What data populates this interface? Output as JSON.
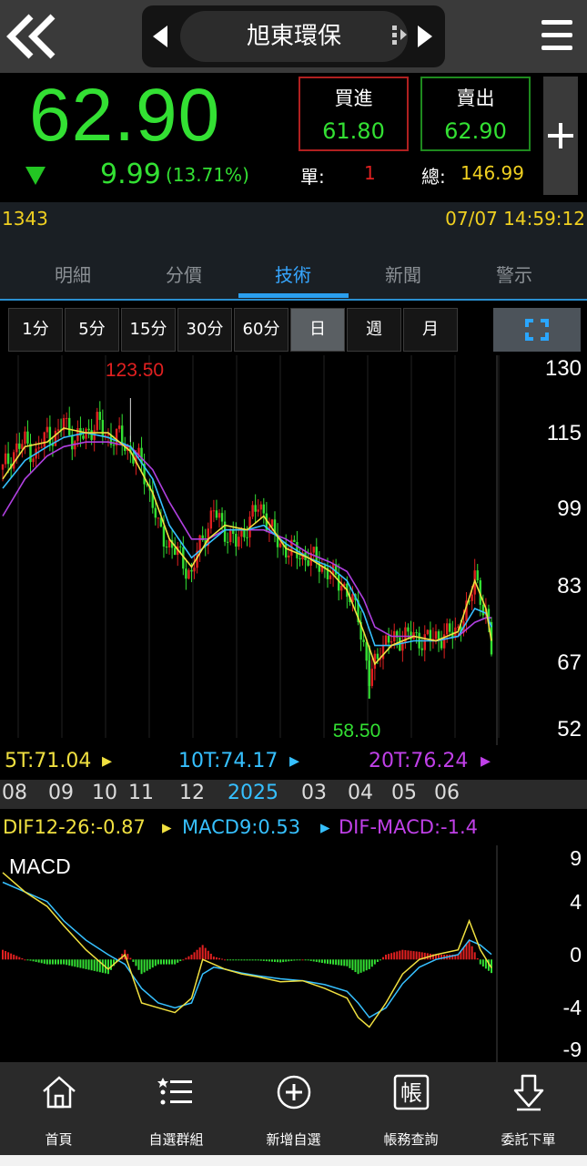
{
  "header": {
    "title": "旭東環保"
  },
  "quote": {
    "price": "62.90",
    "change": "9.99",
    "change_pct": "(13.71%)",
    "buy_label": "買進",
    "buy_price": "61.80",
    "sell_label": "賣出",
    "sell_price": "62.90",
    "unit_label": "單:",
    "unit_value": "1",
    "total_label": "總:",
    "total_value": "146.99",
    "stock_code": "1343",
    "datetime": "07/07 14:59:12"
  },
  "tabs": [
    "明細",
    "分價",
    "技術",
    "新聞",
    "警示"
  ],
  "active_tab": "技術",
  "periods": [
    "1分",
    "5分",
    "15分",
    "30分",
    "60分",
    "日",
    "週",
    "月"
  ],
  "active_period": "日",
  "ma": {
    "ma5": "5T:71.04",
    "ma10": "10T:74.17",
    "ma20": "20T:76.24"
  },
  "date_axis": [
    "08",
    "09",
    "10",
    "11",
    "12",
    "2025",
    "03",
    "04",
    "05",
    "06"
  ],
  "macd_legend": {
    "dif": "DIF12-26:-0.87",
    "macd9": "MACD9:0.53",
    "osc": "DIF-MACD:-1.4",
    "panel_label": "MACD"
  },
  "colors": {
    "up": "#e02020",
    "down": "#33e033",
    "ma5": "#f0e040",
    "ma10": "#36c0ff",
    "ma20": "#b040e0",
    "accent": "#2a9fef"
  },
  "chart_data": [
    {
      "type": "candlestick",
      "title": "",
      "y_ticks": [
        "130",
        "115",
        "99",
        "83",
        "67",
        "52"
      ],
      "ylim": [
        52,
        130
      ],
      "high_label": "123.50",
      "low_label": "58.50",
      "high": 123.5,
      "low": 58.5,
      "close_points": [
        [
          0,
          108
        ],
        [
          2,
          112
        ],
        [
          4,
          114
        ],
        [
          6,
          111
        ],
        [
          8,
          116
        ],
        [
          10,
          115
        ],
        [
          11,
          119
        ],
        [
          13,
          114
        ],
        [
          15,
          116
        ],
        [
          17,
          118
        ],
        [
          19,
          115
        ],
        [
          21,
          115
        ],
        [
          23,
          112
        ],
        [
          25,
          109
        ],
        [
          27,
          101
        ],
        [
          28,
          95
        ],
        [
          30,
          92
        ],
        [
          32,
          89
        ],
        [
          34,
          85
        ],
        [
          35,
          90
        ],
        [
          37,
          96
        ],
        [
          38,
          99
        ],
        [
          40,
          95
        ],
        [
          42,
          92
        ],
        [
          44,
          96
        ],
        [
          46,
          100
        ],
        [
          47,
          99
        ],
        [
          49,
          93
        ],
        [
          51,
          91
        ],
        [
          53,
          90
        ],
        [
          55,
          89
        ],
        [
          57,
          88
        ],
        [
          59,
          85
        ],
        [
          61,
          84
        ],
        [
          62,
          81
        ],
        [
          64,
          77
        ],
        [
          65,
          70
        ],
        [
          66,
          62
        ],
        [
          68,
          70
        ],
        [
          70,
          71
        ],
        [
          72,
          72
        ],
        [
          74,
          72
        ],
        [
          76,
          71
        ],
        [
          78,
          72
        ],
        [
          80,
          72
        ],
        [
          82,
          74
        ],
        [
          84,
          78
        ],
        [
          85,
          87
        ],
        [
          86,
          80
        ],
        [
          87,
          76
        ],
        [
          88,
          69
        ]
      ],
      "ma5": [
        [
          0,
          106
        ],
        [
          4,
          113
        ],
        [
          8,
          114
        ],
        [
          11,
          117
        ],
        [
          15,
          116
        ],
        [
          19,
          116
        ],
        [
          23,
          112
        ],
        [
          27,
          103
        ],
        [
          30,
          93
        ],
        [
          34,
          87
        ],
        [
          37,
          93
        ],
        [
          40,
          96
        ],
        [
          44,
          95
        ],
        [
          47,
          98
        ],
        [
          51,
          91
        ],
        [
          55,
          89
        ],
        [
          59,
          86
        ],
        [
          62,
          82
        ],
        [
          65,
          73
        ],
        [
          67,
          66
        ],
        [
          70,
          70
        ],
        [
          74,
          72
        ],
        [
          78,
          71
        ],
        [
          82,
          73
        ],
        [
          85,
          84
        ],
        [
          87,
          78
        ],
        [
          88,
          71
        ]
      ],
      "ma10": [
        [
          0,
          104
        ],
        [
          4,
          110
        ],
        [
          8,
          113
        ],
        [
          11,
          115
        ],
        [
          15,
          116
        ],
        [
          19,
          115
        ],
        [
          23,
          113
        ],
        [
          27,
          106
        ],
        [
          30,
          96
        ],
        [
          34,
          89
        ],
        [
          37,
          92
        ],
        [
          40,
          95
        ],
        [
          44,
          95
        ],
        [
          47,
          96
        ],
        [
          51,
          92
        ],
        [
          55,
          89
        ],
        [
          59,
          87
        ],
        [
          62,
          84
        ],
        [
          65,
          77
        ],
        [
          67,
          70
        ],
        [
          70,
          70
        ],
        [
          74,
          71
        ],
        [
          78,
          71
        ],
        [
          82,
          72
        ],
        [
          85,
          78
        ],
        [
          87,
          77
        ],
        [
          88,
          74
        ]
      ],
      "ma20": [
        [
          0,
          98
        ],
        [
          4,
          106
        ],
        [
          8,
          111
        ],
        [
          11,
          113
        ],
        [
          15,
          114
        ],
        [
          19,
          114
        ],
        [
          23,
          113
        ],
        [
          27,
          108
        ],
        [
          30,
          101
        ],
        [
          34,
          93
        ],
        [
          37,
          93
        ],
        [
          40,
          95
        ],
        [
          44,
          95
        ],
        [
          47,
          95
        ],
        [
          51,
          93
        ],
        [
          55,
          90
        ],
        [
          59,
          88
        ],
        [
          62,
          86
        ],
        [
          65,
          80
        ],
        [
          67,
          74
        ],
        [
          70,
          72
        ],
        [
          74,
          72
        ],
        [
          78,
          71
        ],
        [
          82,
          72
        ],
        [
          85,
          75
        ],
        [
          87,
          76
        ],
        [
          88,
          76
        ]
      ],
      "x_range": [
        0,
        88
      ]
    },
    {
      "type": "macd",
      "y_ticks": [
        "9",
        "4",
        "0",
        "-4",
        "-9"
      ],
      "ylim": [
        -9.5,
        10.5
      ],
      "dif": [
        [
          0,
          9
        ],
        [
          4,
          7
        ],
        [
          8,
          5.5
        ],
        [
          11,
          3.5
        ],
        [
          15,
          1
        ],
        [
          19,
          -1
        ],
        [
          22,
          0.5
        ],
        [
          25,
          -4.5
        ],
        [
          28,
          -5
        ],
        [
          31,
          -5.5
        ],
        [
          34,
          -4
        ],
        [
          36,
          0
        ],
        [
          38,
          -0.5
        ],
        [
          40,
          -1
        ],
        [
          43,
          -1.5
        ],
        [
          46,
          -1.8
        ],
        [
          50,
          -2.3
        ],
        [
          54,
          -2.2
        ],
        [
          58,
          -3
        ],
        [
          62,
          -4
        ],
        [
          64,
          -6
        ],
        [
          66,
          -7
        ],
        [
          69,
          -4.5
        ],
        [
          72,
          -1.5
        ],
        [
          75,
          0
        ],
        [
          78,
          0.5
        ],
        [
          82,
          1
        ],
        [
          84,
          4
        ],
        [
          86,
          1
        ],
        [
          88,
          -0.87
        ]
      ],
      "macd9": [
        [
          0,
          8
        ],
        [
          4,
          7
        ],
        [
          8,
          6
        ],
        [
          11,
          4
        ],
        [
          15,
          2
        ],
        [
          19,
          0.5
        ],
        [
          22,
          -0.5
        ],
        [
          25,
          -3
        ],
        [
          28,
          -4.5
        ],
        [
          31,
          -5
        ],
        [
          34,
          -4.5
        ],
        [
          36,
          -1.5
        ],
        [
          38,
          -0.8
        ],
        [
          40,
          -1
        ],
        [
          43,
          -1.4
        ],
        [
          46,
          -1.7
        ],
        [
          50,
          -2
        ],
        [
          54,
          -2.2
        ],
        [
          58,
          -2.6
        ],
        [
          62,
          -3.3
        ],
        [
          64,
          -4.5
        ],
        [
          66,
          -6
        ],
        [
          69,
          -5
        ],
        [
          72,
          -2.5
        ],
        [
          75,
          -0.8
        ],
        [
          78,
          0
        ],
        [
          82,
          0.5
        ],
        [
          84,
          2
        ],
        [
          86,
          1.5
        ],
        [
          88,
          0.53
        ]
      ],
      "x_range": [
        0,
        88
      ]
    }
  ],
  "bottom_nav": [
    {
      "label": "首頁",
      "icon": "home-icon"
    },
    {
      "label": "自選群組",
      "icon": "list-icon"
    },
    {
      "label": "新增自選",
      "icon": "add-circle-icon"
    },
    {
      "label": "帳務查詢",
      "icon": "account-icon"
    },
    {
      "label": "委託下單",
      "icon": "order-icon"
    }
  ],
  "nav_account_glyph": "帳"
}
